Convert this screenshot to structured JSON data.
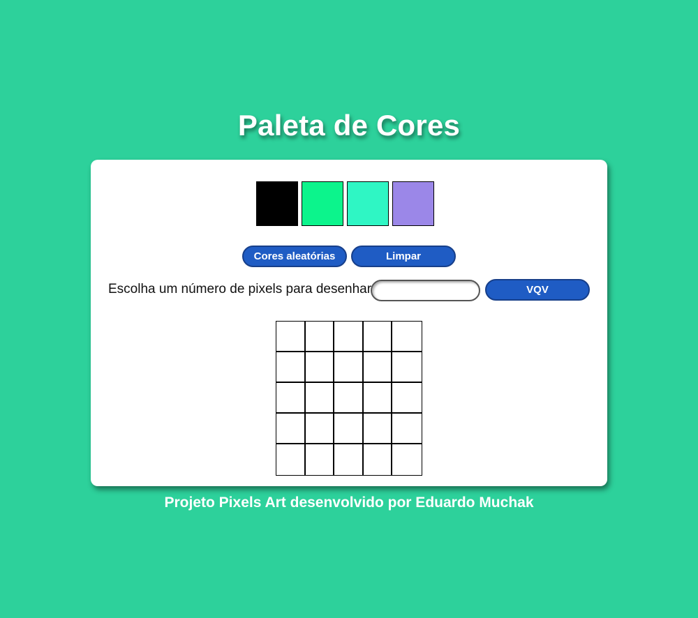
{
  "header": {
    "title": "Paleta de Cores"
  },
  "palette": {
    "colors": [
      "#000000",
      "#0cf48c",
      "#2ff6c4",
      "#9b87e8"
    ]
  },
  "controls": {
    "random_colors_label": "Cores aleatórias",
    "clear_label": "Limpar",
    "pixel_prompt": "Escolha um número de pixels para desenhar:",
    "board_size_value": "",
    "generate_label": "VQV"
  },
  "board": {
    "rows": 5,
    "columns": 5
  },
  "footer": {
    "text": "Projeto Pixels Art desenvolvido por Eduardo Muchak"
  },
  "colors": {
    "background": "#2dd19b",
    "button": "#1f5cc4",
    "card": "#ffffff"
  }
}
